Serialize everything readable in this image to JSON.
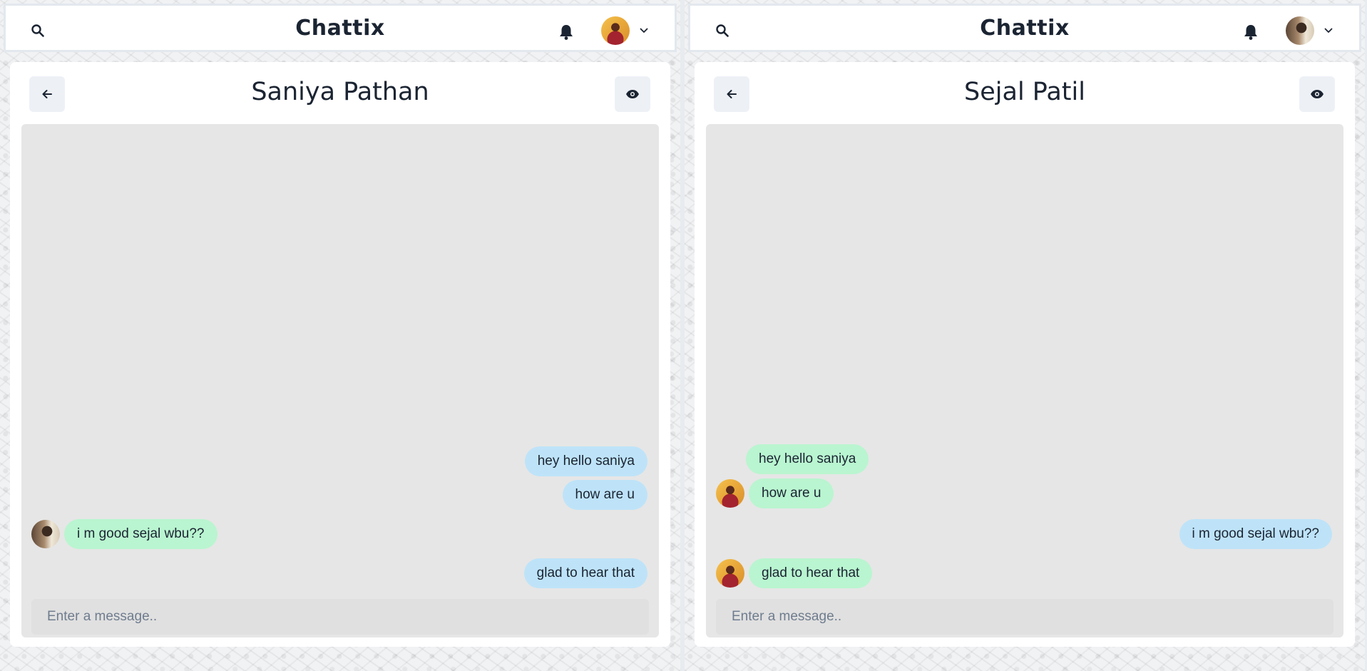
{
  "app": {
    "brand": "Chattix"
  },
  "colors": {
    "sent_bubble": "#bee3f8",
    "received_bubble": "#b9f5d0",
    "chat_area": "#e6e6e6",
    "text": "#1b2432"
  },
  "icons": {
    "search": "search-icon",
    "notifications": "bell-icon",
    "profile_menu": "chevron-down-icon",
    "back": "arrow-left-icon",
    "view_profile": "eye-icon"
  },
  "left": {
    "chat_title": "Saniya Pathan",
    "input_placeholder": "Enter a message..",
    "messages": [
      {
        "direction": "sent",
        "text": "hey hello saniya"
      },
      {
        "direction": "sent",
        "text": "how are u"
      },
      {
        "direction": "received",
        "text": "i m good sejal wbu??"
      },
      {
        "direction": "sent",
        "text": "glad to hear that"
      }
    ]
  },
  "right": {
    "chat_title": "Sejal Patil",
    "input_placeholder": "Enter a message..",
    "messages": [
      {
        "direction": "received",
        "text": "hey hello saniya"
      },
      {
        "direction": "received",
        "text": "how are u"
      },
      {
        "direction": "sent",
        "text": "i m good sejal wbu??"
      },
      {
        "direction": "received",
        "text": "glad to hear that"
      }
    ]
  }
}
